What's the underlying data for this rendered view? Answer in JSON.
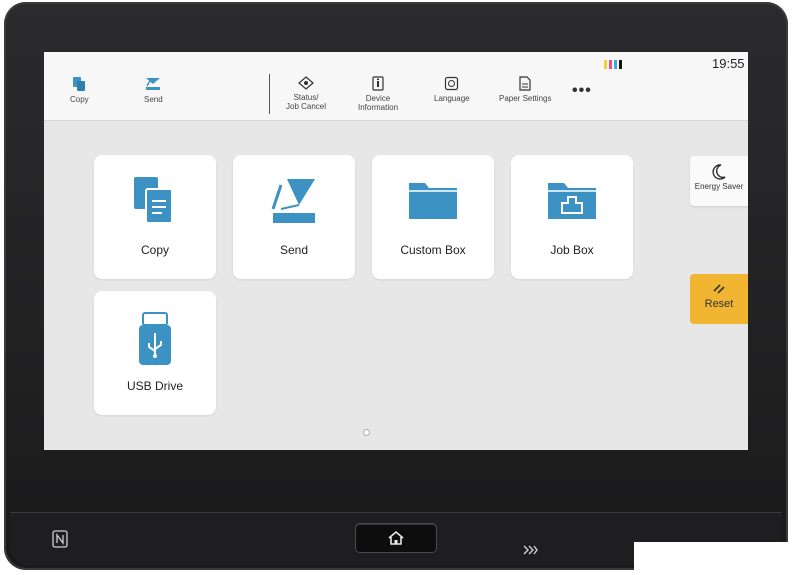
{
  "topbar": {
    "shortcuts": [
      {
        "label": "Copy",
        "icon": "copy-icon"
      },
      {
        "label": "Send",
        "icon": "send-icon"
      }
    ],
    "functions": [
      {
        "line1": "Status/",
        "line2": "Job Cancel",
        "icon": "status-eye-icon"
      },
      {
        "line1": "Device",
        "line2": "Information",
        "icon": "device-info-icon"
      },
      {
        "line1": "Language",
        "line2": "",
        "icon": "language-icon"
      },
      {
        "line1": "Paper Settings",
        "line2": "",
        "icon": "paper-settings-icon"
      }
    ],
    "more_label": "•••",
    "time": "19:55",
    "toner_colors": [
      "#f2d23a",
      "#e8508a",
      "#3fa9d9",
      "#111111"
    ]
  },
  "tiles": [
    {
      "label": "Copy",
      "icon": "copy-icon"
    },
    {
      "label": "Send",
      "icon": "send-icon"
    },
    {
      "label": "Custom Box",
      "icon": "folder-icon"
    },
    {
      "label": "Job Box",
      "icon": "job-box-folder-icon"
    },
    {
      "label": "USB Drive",
      "icon": "usb-drive-icon"
    }
  ],
  "side": {
    "energy_label": "Energy Saver",
    "reset_label": "Reset"
  },
  "colors": {
    "accent_blue": "#3c93c3",
    "reset_yellow": "#f2b531"
  }
}
